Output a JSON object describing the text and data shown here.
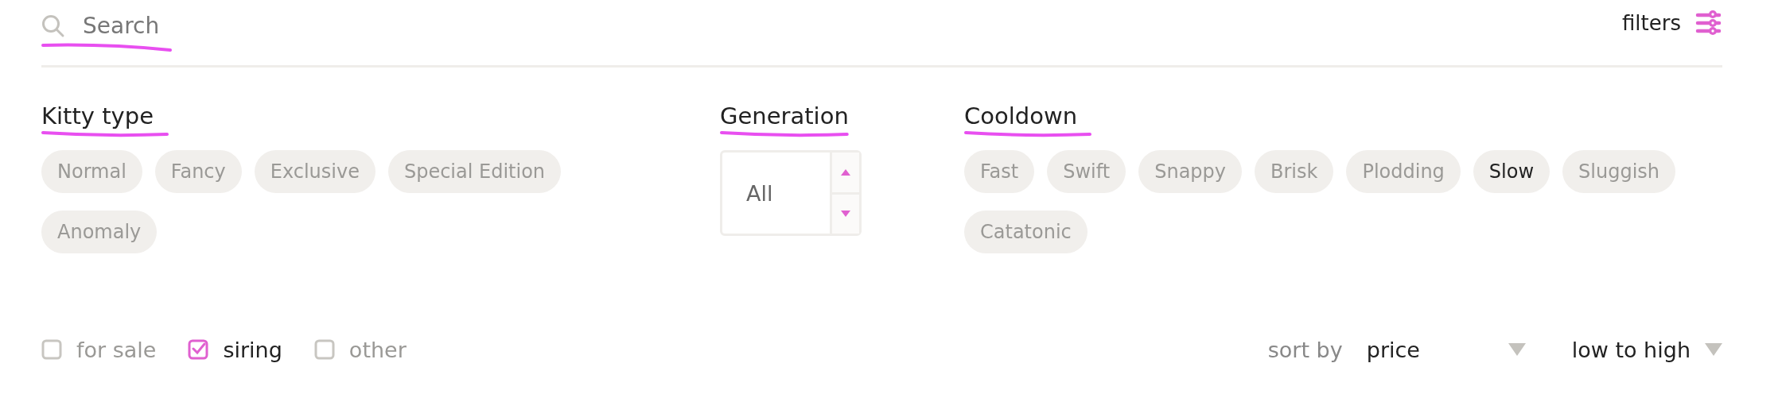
{
  "search": {
    "placeholder": "Search"
  },
  "filters_button": {
    "label": "filters"
  },
  "sections": [
    {
      "kind": "chips",
      "title": "Kitty type",
      "options": [
        {
          "label": "Normal",
          "selected": false
        },
        {
          "label": "Fancy",
          "selected": false
        },
        {
          "label": "Exclusive",
          "selected": false
        },
        {
          "label": "Special Edition",
          "selected": false
        },
        {
          "label": "Anomaly",
          "selected": false
        }
      ]
    },
    {
      "kind": "spinner",
      "title": "Generation",
      "value": "All"
    },
    {
      "kind": "chips",
      "title": "Cooldown",
      "options": [
        {
          "label": "Fast",
          "selected": false
        },
        {
          "label": "Swift",
          "selected": false
        },
        {
          "label": "Snappy",
          "selected": false
        },
        {
          "label": "Brisk",
          "selected": false
        },
        {
          "label": "Plodding",
          "selected": false
        },
        {
          "label": "Slow",
          "selected": true
        },
        {
          "label": "Sluggish",
          "selected": false
        },
        {
          "label": "Catatonic",
          "selected": false
        }
      ]
    }
  ],
  "listing_filters": [
    {
      "label": "for sale",
      "checked": false
    },
    {
      "label": "siring",
      "checked": true
    },
    {
      "label": "other",
      "checked": false
    }
  ],
  "sort": {
    "label": "sort by",
    "field": "price",
    "order": "low to high"
  }
}
